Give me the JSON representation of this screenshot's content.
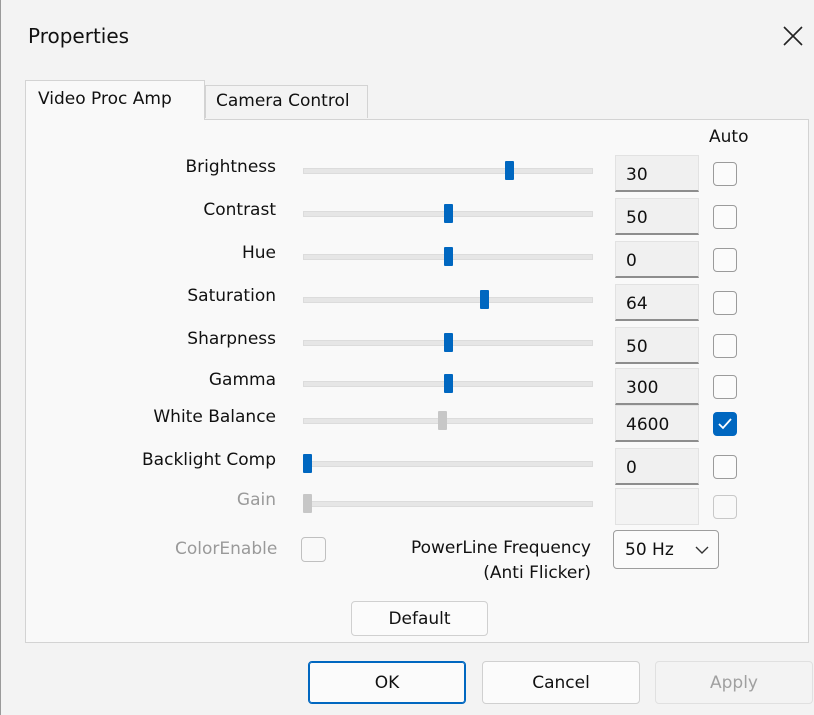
{
  "window": {
    "title": "Properties"
  },
  "tabs": [
    {
      "label": "Video Proc Amp",
      "active": true
    },
    {
      "label": "Camera Control",
      "active": false
    }
  ],
  "auto_header": "Auto",
  "properties": [
    {
      "label": "Brightness",
      "value": "30",
      "slider_fraction": 0.72,
      "auto": false,
      "enabled": true
    },
    {
      "label": "Contrast",
      "value": "50",
      "slider_fraction": 0.5,
      "auto": false,
      "enabled": true
    },
    {
      "label": "Hue",
      "value": "0",
      "slider_fraction": 0.5,
      "auto": false,
      "enabled": true
    },
    {
      "label": "Saturation",
      "value": "64",
      "slider_fraction": 0.63,
      "auto": false,
      "enabled": true
    },
    {
      "label": "Sharpness",
      "value": "50",
      "slider_fraction": 0.5,
      "auto": false,
      "enabled": true
    },
    {
      "label": "Gamma",
      "value": "300",
      "slider_fraction": 0.5,
      "auto": false,
      "enabled": true
    },
    {
      "label": "White Balance",
      "value": "4600",
      "slider_fraction": 0.48,
      "auto": true,
      "enabled": true
    },
    {
      "label": "Backlight Comp",
      "value": "0",
      "slider_fraction": 0.0,
      "auto": false,
      "enabled": true
    },
    {
      "label": "Gain",
      "value": "",
      "slider_fraction": 0.0,
      "auto": false,
      "enabled": false
    }
  ],
  "color_enable": {
    "label": "ColorEnable",
    "checked": false,
    "enabled": false
  },
  "powerline": {
    "label_line1": "PowerLine Frequency",
    "label_line2": "(Anti Flicker)",
    "selected": "50 Hz"
  },
  "buttons": {
    "default": "Default",
    "ok": "OK",
    "cancel": "Cancel",
    "apply": "Apply"
  },
  "colors": {
    "accent": "#0067c0",
    "disabled_thumb": "#c7c7c7"
  },
  "icons": {
    "close": "close-icon",
    "dropdown": "chevron-down-icon",
    "check": "checkmark-icon"
  }
}
